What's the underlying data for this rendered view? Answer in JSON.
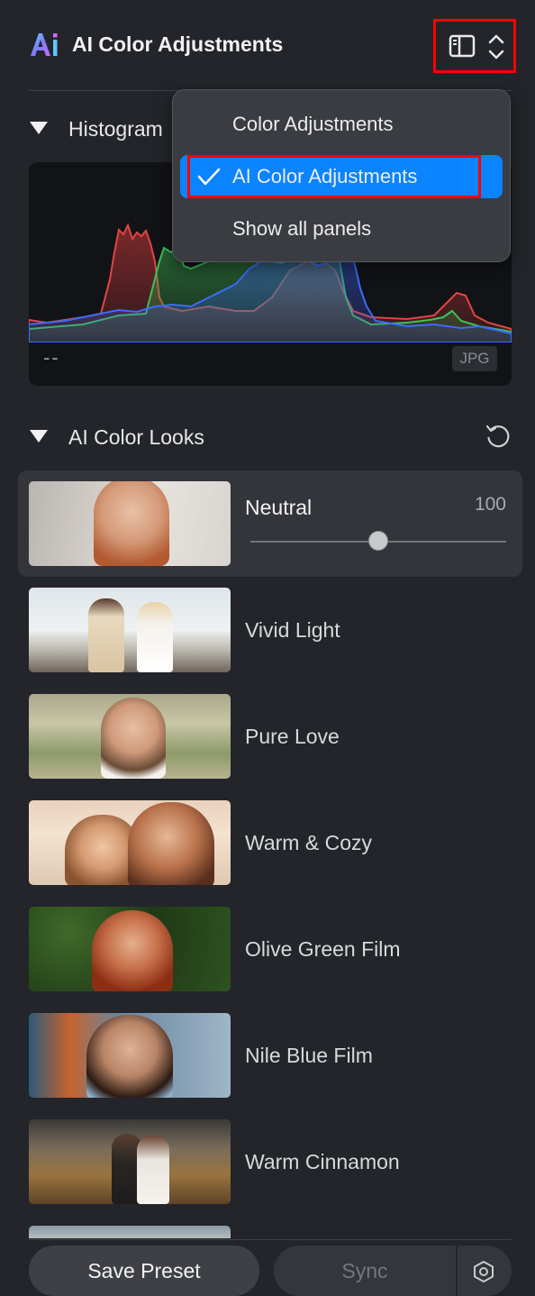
{
  "header": {
    "title": "AI Color Adjustments",
    "logo_text": "Ai"
  },
  "histogram": {
    "title": "Histogram",
    "exposure_readout": "--",
    "format_badge": "JPG"
  },
  "panel_menu": {
    "items": [
      {
        "label": "Color Adjustments",
        "checked": false
      },
      {
        "label": "AI Color Adjustments",
        "checked": true
      },
      {
        "label": "Show all panels",
        "checked": false
      }
    ]
  },
  "looks": {
    "title": "AI Color Looks",
    "selected": {
      "name": "Neutral",
      "value": "100",
      "strength": 0.5
    },
    "items": [
      {
        "name": "Neutral"
      },
      {
        "name": "Vivid Light"
      },
      {
        "name": "Pure Love"
      },
      {
        "name": "Warm & Cozy"
      },
      {
        "name": "Olive Green Film"
      },
      {
        "name": "Nile Blue Film"
      },
      {
        "name": "Warm Cinnamon"
      }
    ]
  },
  "footer": {
    "save_preset_label": "Save Preset",
    "sync_label": "Sync"
  },
  "colors": {
    "accent": "#0a84ff",
    "highlight_box": "#ff0000",
    "background": "#23252a"
  }
}
